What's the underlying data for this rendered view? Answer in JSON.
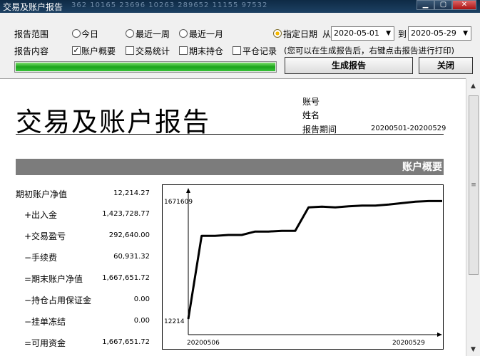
{
  "window": {
    "title": "交易及账户报告",
    "ghost_text": "362     10165     23696     10263     289652     11155     97532"
  },
  "controls": {
    "range_label": "报告范围",
    "content_label": "报告内容",
    "range_options": [
      "今日",
      "最近一周",
      "最近一月",
      "指定日期"
    ],
    "selected_range": "指定日期",
    "from_label": "从",
    "to_label": "到",
    "date_from": "2020-05-01",
    "date_to": "2020-05-29",
    "content_options": [
      {
        "label": "账户概要",
        "checked": true
      },
      {
        "label": "交易统计",
        "checked": false
      },
      {
        "label": "期末持仓",
        "checked": false
      },
      {
        "label": "平仓记录",
        "checked": false
      }
    ],
    "hint": "(您可以在生成报告后，右键点击报告进行打印)",
    "progress": 1.0,
    "generate_label": "生成报告",
    "close_label": "关闭"
  },
  "report": {
    "title": "交易及账户报告",
    "account_label": "账号",
    "name_label": "姓名",
    "period_label": "报告期间",
    "period_value": "20200501-20200529",
    "section_title": "账户概要",
    "rows": [
      {
        "label": "期初账户净值",
        "value": "12,214.27"
      },
      {
        "label": "+出入金",
        "value": "1,423,728.77"
      },
      {
        "label": "+交易盈亏",
        "value": "292,640.00"
      },
      {
        "label": "−手续费",
        "value": "60,931.32"
      },
      {
        "label": "=期末账户净值",
        "value": "1,667,651.72"
      },
      {
        "label": "−持仓占用保证金",
        "value": "0.00"
      },
      {
        "label": "−挂单冻结",
        "value": "0.00"
      },
      {
        "label": "=可用资金",
        "value": "1,667,651.72"
      }
    ]
  },
  "chart_data": {
    "type": "line",
    "y_max_label": "1671609",
    "y_min_label": "12214",
    "x_start_label": "20200506",
    "x_end_label": "20200529",
    "ylim": [
      12214,
      1671609
    ],
    "values": [
      12214,
      1180000,
      1180000,
      1192000,
      1192000,
      1240000,
      1240000,
      1250000,
      1250000,
      1580000,
      1590000,
      1580000,
      1595000,
      1605000,
      1605000,
      1620000,
      1640000,
      1660000,
      1667652,
      1667652
    ]
  }
}
